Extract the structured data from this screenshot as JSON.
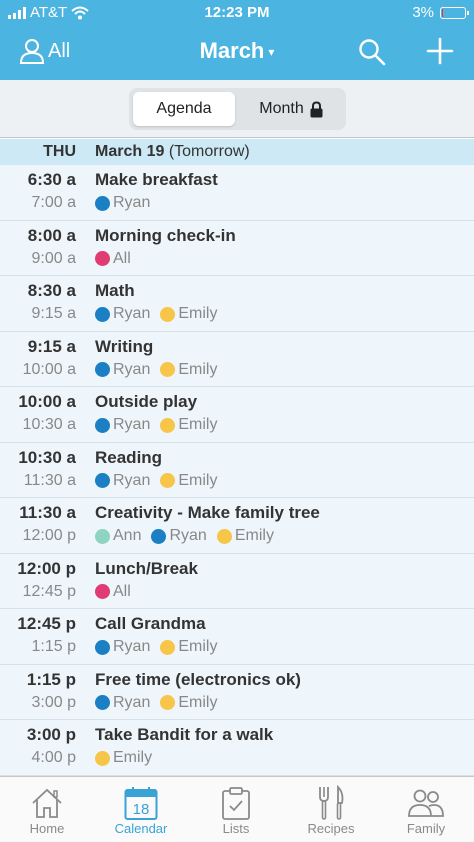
{
  "status": {
    "carrier": "AT&T",
    "time": "12:23 PM",
    "battery": "3%"
  },
  "nav": {
    "filter_label": "All",
    "month_title": "March",
    "caret": "▾"
  },
  "view_toggle": {
    "agenda_label": "Agenda",
    "month_label": "Month"
  },
  "day_header": {
    "dow": "THU",
    "date": "March 19",
    "note": "(Tomorrow)"
  },
  "events": [
    {
      "start": "6:30 a",
      "end": "7:00 a",
      "title": "Make breakfast",
      "members": [
        {
          "name": "Ryan",
          "color": "#1b7fc4"
        }
      ]
    },
    {
      "start": "8:00 a",
      "end": "9:00 a",
      "title": "Morning check-in",
      "members": [
        {
          "name": "All",
          "color": "#e03b72"
        }
      ]
    },
    {
      "start": "8:30 a",
      "end": "9:15 a",
      "title": "Math",
      "members": [
        {
          "name": "Ryan",
          "color": "#1b7fc4"
        },
        {
          "name": "Emily",
          "color": "#f7c548"
        }
      ]
    },
    {
      "start": "9:15 a",
      "end": "10:00 a",
      "title": "Writing",
      "members": [
        {
          "name": "Ryan",
          "color": "#1b7fc4"
        },
        {
          "name": "Emily",
          "color": "#f7c548"
        }
      ]
    },
    {
      "start": "10:00 a",
      "end": "10:30 a",
      "title": "Outside play",
      "members": [
        {
          "name": "Ryan",
          "color": "#1b7fc4"
        },
        {
          "name": "Emily",
          "color": "#f7c548"
        }
      ]
    },
    {
      "start": "10:30 a",
      "end": "11:30 a",
      "title": "Reading",
      "members": [
        {
          "name": "Ryan",
          "color": "#1b7fc4"
        },
        {
          "name": "Emily",
          "color": "#f7c548"
        }
      ]
    },
    {
      "start": "11:30 a",
      "end": "12:00 p",
      "title": "Creativity - Make family tree",
      "members": [
        {
          "name": "Ann",
          "color": "#8ed4c1"
        },
        {
          "name": "Ryan",
          "color": "#1b7fc4"
        },
        {
          "name": "Emily",
          "color": "#f7c548"
        }
      ]
    },
    {
      "start": "12:00 p",
      "end": "12:45 p",
      "title": "Lunch/Break",
      "members": [
        {
          "name": "All",
          "color": "#e03b72"
        }
      ]
    },
    {
      "start": "12:45 p",
      "end": "1:15 p",
      "title": "Call Grandma",
      "members": [
        {
          "name": "Ryan",
          "color": "#1b7fc4"
        },
        {
          "name": "Emily",
          "color": "#f7c548"
        }
      ]
    },
    {
      "start": "1:15 p",
      "end": "3:00 p",
      "title": "Free time (electronics ok)",
      "members": [
        {
          "name": "Ryan",
          "color": "#1b7fc4"
        },
        {
          "name": "Emily",
          "color": "#f7c548"
        }
      ]
    },
    {
      "start": "3:00 p",
      "end": "4:00 p",
      "title": "Take Bandit for a walk",
      "members": [
        {
          "name": "Emily",
          "color": "#f7c548"
        }
      ]
    }
  ],
  "tabs": [
    {
      "label": "Home",
      "icon": "home-icon",
      "active": false
    },
    {
      "label": "Calendar",
      "icon": "calendar-icon",
      "active": true,
      "badge": "18"
    },
    {
      "label": "Lists",
      "icon": "clipboard-icon",
      "active": false
    },
    {
      "label": "Recipes",
      "icon": "fork-knife-icon",
      "active": false
    },
    {
      "label": "Family",
      "icon": "people-icon",
      "active": false
    }
  ]
}
